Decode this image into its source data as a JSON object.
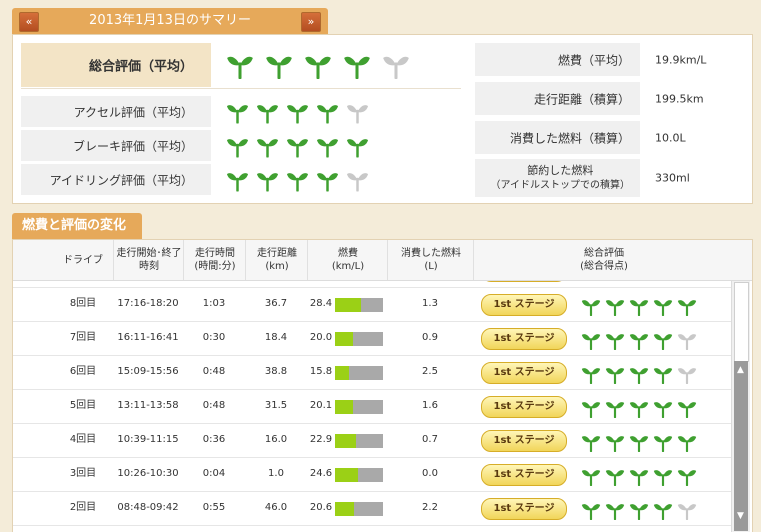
{
  "summary": {
    "title": "2013年1月13日のサマリー",
    "prev_label": "«",
    "next_label": "»",
    "overall_label": "総合評価（平均）",
    "overall_rating": 4.5,
    "ratings": [
      {
        "label": "アクセル評価（平均）",
        "rating": 4.5
      },
      {
        "label": "ブレーキ評価（平均）",
        "rating": 5
      },
      {
        "label": "アイドリング評価（平均）",
        "rating": 4.5
      }
    ],
    "stats": [
      {
        "label": "燃費（平均）",
        "value": "19.9km/L"
      },
      {
        "label": "走行距離（積算）",
        "value": "199.5km"
      },
      {
        "label": "消費した燃料（積算）",
        "value": "10.0L"
      },
      {
        "label": "節約した燃料",
        "label2": "（アイドルストップでの積算）",
        "value": "330ml"
      }
    ]
  },
  "history": {
    "title": "燃費と評価の変化",
    "headers": {
      "drive": "ドライブ",
      "time_l1": "走行開始･終了",
      "time_l2": "時刻",
      "duration_l1": "走行時間",
      "duration_l2": "(時間:分)",
      "distance_l1": "走行距離",
      "distance_l2": "(km)",
      "fuel_l1": "燃費",
      "fuel_l2": "(km/L)",
      "used_l1": "消費した燃料",
      "used_l2": "(L)",
      "rating_l1": "総合評価",
      "rating_l2": "(総合得点)"
    },
    "stage_label": "1st ステージ",
    "rows": [
      {
        "drive": "8回目",
        "time": "17:16-18:20",
        "duration": "1:03",
        "distance": "36.7",
        "fuel": "28.4",
        "fuel_fill": 0.55,
        "used": "1.3",
        "rating": 5
      },
      {
        "drive": "7回目",
        "time": "16:11-16:41",
        "duration": "0:30",
        "distance": "18.4",
        "fuel": "20.0",
        "fuel_fill": 0.38,
        "used": "0.9",
        "rating": 4.5
      },
      {
        "drive": "6回目",
        "time": "15:09-15:56",
        "duration": "0:48",
        "distance": "38.8",
        "fuel": "15.8",
        "fuel_fill": 0.3,
        "used": "2.5",
        "rating": 4.5
      },
      {
        "drive": "5回目",
        "time": "13:11-13:58",
        "duration": "0:48",
        "distance": "31.5",
        "fuel": "20.1",
        "fuel_fill": 0.38,
        "used": "1.6",
        "rating": 5
      },
      {
        "drive": "4回目",
        "time": "10:39-11:15",
        "duration": "0:36",
        "distance": "16.0",
        "fuel": "22.9",
        "fuel_fill": 0.44,
        "used": "0.7",
        "rating": 5
      },
      {
        "drive": "3回目",
        "time": "10:26-10:30",
        "duration": "0:04",
        "distance": "1.0",
        "fuel": "24.6",
        "fuel_fill": 0.47,
        "used": "0.0",
        "rating": 5
      },
      {
        "drive": "2回目",
        "time": "08:48-09:42",
        "duration": "0:55",
        "distance": "46.0",
        "fuel": "20.6",
        "fuel_fill": 0.39,
        "used": "2.2",
        "rating": 4.5
      }
    ]
  },
  "scrollbar": {
    "up_icon": "▲",
    "down_icon": "▼"
  },
  "colors": {
    "sprout_full": "#3fa030",
    "sprout_faded": "#c8c8c8",
    "accent": "#e6a95a",
    "fuel_bar": "#9bd016"
  }
}
